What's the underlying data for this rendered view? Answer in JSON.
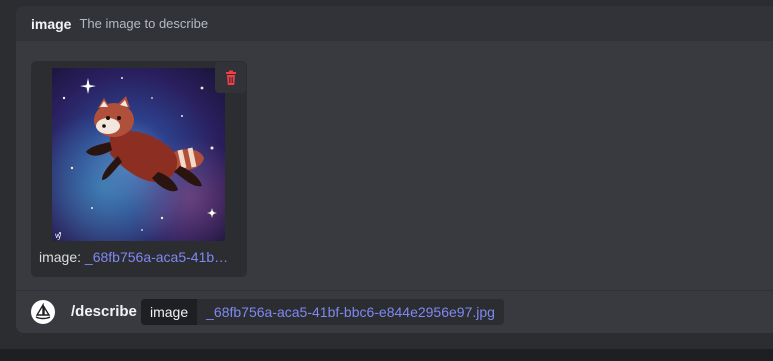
{
  "option": {
    "name": "image",
    "description": "The image to describe"
  },
  "attachment": {
    "caption_prefix": "image:",
    "filename_truncated": "_68fb756a-aca5-41b…",
    "delete_icon": "trash-icon",
    "delete_color": "#f23f43"
  },
  "command": {
    "avatar_icon": "midjourney-sailboat-icon",
    "name": "/describe",
    "param_key": "image",
    "param_value": "_68fb756a-aca5-41bf-bbc6-e844e2956e97.jpg"
  },
  "theme": {
    "background": "#2b2d31",
    "panel": "#383a40",
    "link": "#7f88f2"
  }
}
